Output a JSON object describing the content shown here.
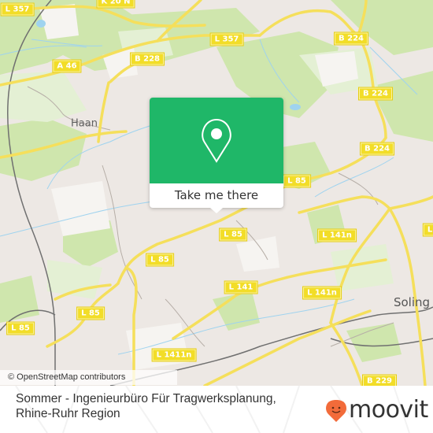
{
  "map": {
    "attribution": "© OpenStreetMap contributors",
    "colors": {
      "land": "#ede8e4",
      "forest": "#cfe6ad",
      "park": "#dcecc6",
      "road": "#f5df5b",
      "water": "#9fd3ef",
      "rail": "#666666"
    },
    "place_labels": [
      {
        "name": "Haan",
        "kind": "town"
      },
      {
        "name": "Soling",
        "kind": "city"
      }
    ],
    "road_labels": [
      {
        "id": "l357-a",
        "text": "L 357"
      },
      {
        "id": "k20n",
        "text": "K 20 N"
      },
      {
        "id": "l357-b",
        "text": "L 357"
      },
      {
        "id": "b224-a",
        "text": "B 224"
      },
      {
        "id": "b228",
        "text": "B 228"
      },
      {
        "id": "a46",
        "text": "A 46"
      },
      {
        "id": "b224-b",
        "text": "B 224"
      },
      {
        "id": "b224-c",
        "text": "B 224"
      },
      {
        "id": "l85-a",
        "text": "L 85"
      },
      {
        "id": "l85-b",
        "text": "L 85"
      },
      {
        "id": "l141n-a",
        "text": "L 141n"
      },
      {
        "id": "l141n-b",
        "text": "L 141n"
      },
      {
        "id": "l85-c",
        "text": "L 85"
      },
      {
        "id": "l141",
        "text": "L 141"
      },
      {
        "id": "l141n-c",
        "text": "L 141n"
      },
      {
        "id": "l85-d",
        "text": "L 85"
      },
      {
        "id": "l85-e",
        "text": "L 85"
      },
      {
        "id": "l85-f",
        "text": "L 85"
      },
      {
        "id": "l141n-d",
        "text": "L 1411n"
      },
      {
        "id": "b229",
        "text": "B 229"
      },
      {
        "id": "l-edge",
        "text": "L"
      }
    ]
  },
  "popup": {
    "icon": "location-pin-icon",
    "label": "Take me there",
    "color": "#1fb768"
  },
  "footer": {
    "title": "Sommer - Ingenieurbüro Für Tragwerksplanung, Rhine-Ruhr Region",
    "logo_text": "moovit",
    "logo_color": "#f26b3a"
  }
}
